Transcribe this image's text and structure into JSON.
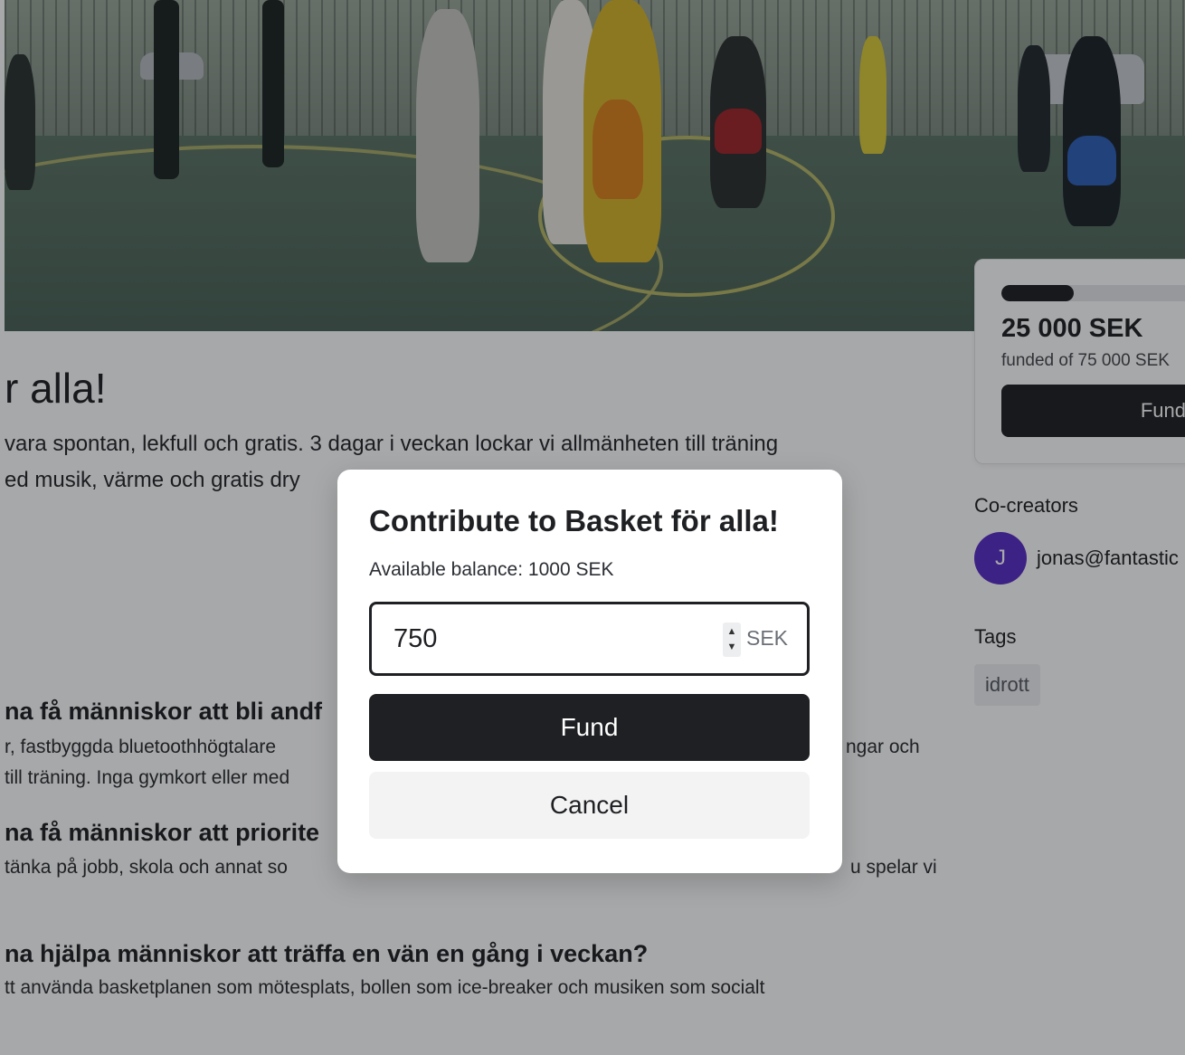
{
  "project": {
    "title": "r alla!",
    "lead_lines": [
      "vara spontan, lekfull och gratis. 3 dagar i veckan lockar vi allmänheten till träning",
      "ed musik, värme och gratis dry"
    ],
    "sections": [
      {
        "heading": "na få människor att bli andf",
        "lines": [
          "r, fastbyggda bluetoothhögtalare",
          "till träning. Inga gymkort eller med"
        ],
        "right_fragment": "ngar och"
      },
      {
        "heading": "na få människor att priorite",
        "lines": [
          "tänka på jobb, skola och annat so"
        ],
        "right_fragment": "u spelar vi"
      },
      {
        "heading": "na hjälpa människor att träffa en vän en gång i veckan?",
        "lines": [
          "tt använda basketplanen som mötesplats, bollen som ice-breaker och musiken som socialt"
        ]
      }
    ]
  },
  "funding": {
    "amount": "25 000 SEK",
    "funded_of": "funded of 75 000 SEK",
    "progress_fraction": 0.3333,
    "button_label": "Fund"
  },
  "co_creators": {
    "heading": "Co-creators",
    "items": [
      {
        "initial": "J",
        "email": "jonas@fantastic",
        "avatar_color": "#5a2ec8"
      }
    ]
  },
  "tags": {
    "heading": "Tags",
    "items": [
      "idrott"
    ]
  },
  "modal": {
    "title": "Contribute to Basket för alla!",
    "balance": "Available balance: 1000 SEK",
    "amount_value": "750",
    "unit": "SEK",
    "fund_label": "Fund",
    "cancel_label": "Cancel"
  },
  "colors": {
    "primary": "#1f2023",
    "avatar": "#5a2ec8",
    "overlay": "rgba(12,14,18,0.36)"
  },
  "icons": {
    "stepper_up": "chevron-up-icon",
    "stepper_down": "chevron-down-icon"
  }
}
